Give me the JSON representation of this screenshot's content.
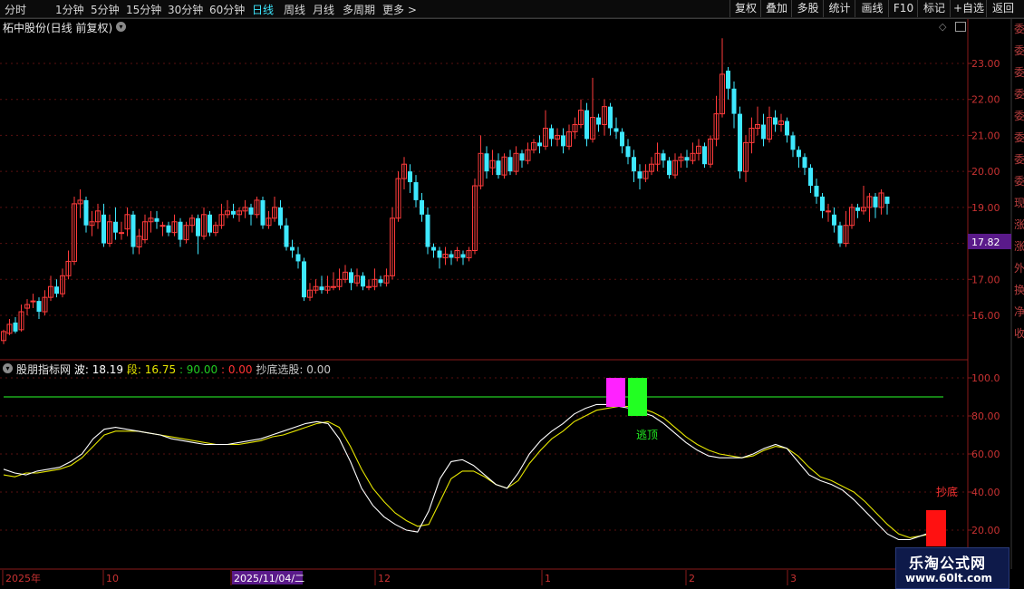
{
  "toolbar": {
    "periods": [
      "分时",
      "1分钟",
      "5分钟",
      "15分钟",
      "30分钟",
      "60分钟",
      "日线",
      "周线",
      "月线",
      "多周期",
      "更多 >"
    ],
    "active_period": "日线",
    "right_buttons": [
      "复权",
      "叠加",
      "多股",
      "统计",
      "画线",
      "F10",
      "标记",
      "+自选",
      "返回"
    ]
  },
  "stock": {
    "title": "柘中股份(日线 前复权)"
  },
  "price_axis": {
    "labels": [
      "23.00",
      "22.00",
      "21.00",
      "20.00",
      "19.00",
      "17.00",
      "16.00"
    ],
    "current_price": "17.82",
    "current_price_color": "#5a1a8a"
  },
  "side_labels": [
    "委",
    "委",
    "委",
    "委",
    "委",
    "委",
    "委",
    "委",
    "现",
    "涨",
    "涨",
    "外",
    "换",
    "净",
    "收"
  ],
  "indicator": {
    "name": "股朋指标网",
    "wave_label": "波: 18.19",
    "segment_label": "段: 16.75",
    "level_90": ": 90.00",
    "level_0": ": 0.00",
    "screen_label": "抄底选股: 0.00",
    "axis_labels": [
      "100.0",
      "80.00",
      "60.00",
      "40.00",
      "20.00"
    ],
    "signal_top": "逃顶",
    "signal_bottom": "抄底",
    "colors": {
      "wave": "#ffffff",
      "segment": "#e6e600",
      "level_line": "#22cc22",
      "top_block": "#ff22ff",
      "escape_block": "#22ff22",
      "bottom_block": "#ff1111"
    }
  },
  "date_axis": {
    "labels": [
      "2025年",
      "10",
      "2025/11/04/二",
      "12",
      "1",
      "2",
      "3"
    ]
  },
  "watermark": {
    "name": "乐淘公式网",
    "url": "www.60lt.com"
  },
  "candle_colors": {
    "up": "#ff3b3b",
    "down": "#3ee8ff"
  },
  "candles": [
    [
      15.3,
      15.55,
      15.2,
      15.6
    ],
    [
      15.5,
      15.75,
      15.45,
      15.9
    ],
    [
      15.8,
      15.55,
      15.5,
      15.95
    ],
    [
      15.6,
      16.1,
      15.55,
      16.3
    ],
    [
      16.2,
      16.3,
      16.0,
      16.45
    ],
    [
      16.4,
      16.4,
      16.2,
      16.6
    ],
    [
      16.4,
      16.1,
      15.9,
      16.5
    ],
    [
      16.1,
      16.5,
      16.0,
      16.7
    ],
    [
      16.5,
      16.8,
      16.4,
      17.1
    ],
    [
      16.8,
      16.6,
      16.5,
      17.0
    ],
    [
      16.6,
      17.1,
      16.5,
      17.3
    ],
    [
      17.1,
      17.5,
      17.0,
      17.8
    ],
    [
      17.5,
      19.1,
      17.4,
      19.3
    ],
    [
      19.1,
      19.2,
      18.7,
      19.5
    ],
    [
      19.2,
      18.5,
      18.3,
      19.3
    ],
    [
      18.5,
      18.6,
      18.2,
      18.9
    ],
    [
      18.6,
      18.9,
      18.4,
      19.1
    ],
    [
      18.8,
      18.0,
      17.9,
      19.1
    ],
    [
      18.0,
      18.6,
      17.9,
      18.8
    ],
    [
      18.6,
      18.3,
      18.1,
      19.0
    ],
    [
      18.3,
      18.3,
      18.1,
      18.6
    ],
    [
      18.4,
      18.8,
      18.2,
      19.0
    ],
    [
      18.8,
      17.9,
      17.7,
      18.9
    ],
    [
      17.9,
      18.2,
      17.7,
      18.4
    ],
    [
      18.1,
      18.6,
      18.0,
      18.8
    ],
    [
      18.6,
      18.7,
      18.3,
      18.9
    ],
    [
      18.7,
      18.6,
      18.4,
      18.9
    ],
    [
      18.5,
      18.5,
      18.2,
      18.6
    ],
    [
      18.5,
      18.3,
      18.2,
      18.6
    ],
    [
      18.3,
      18.6,
      18.2,
      18.8
    ],
    [
      18.6,
      18.1,
      17.9,
      18.7
    ],
    [
      18.1,
      18.5,
      18.0,
      18.6
    ],
    [
      18.5,
      18.7,
      18.3,
      18.8
    ],
    [
      18.7,
      18.2,
      17.7,
      18.8
    ],
    [
      18.2,
      18.8,
      18.1,
      19.0
    ],
    [
      18.8,
      18.3,
      18.2,
      18.9
    ],
    [
      18.3,
      18.5,
      18.2,
      18.6
    ],
    [
      18.5,
      18.8,
      18.4,
      19.1
    ],
    [
      18.8,
      18.9,
      18.7,
      19.2
    ],
    [
      18.9,
      18.8,
      18.7,
      19.1
    ],
    [
      18.8,
      18.9,
      18.6,
      19.0
    ],
    [
      18.9,
      19.0,
      18.7,
      19.2
    ],
    [
      19.0,
      18.8,
      18.5,
      19.1
    ],
    [
      18.8,
      19.2,
      18.7,
      19.3
    ],
    [
      19.2,
      18.5,
      18.4,
      19.3
    ],
    [
      18.5,
      18.7,
      18.4,
      18.9
    ],
    [
      18.7,
      19.0,
      18.6,
      19.3
    ],
    [
      19.0,
      18.5,
      18.4,
      19.2
    ],
    [
      18.5,
      17.9,
      17.8,
      18.7
    ],
    [
      17.9,
      17.8,
      17.6,
      18.1
    ],
    [
      17.7,
      17.5,
      17.3,
      17.9
    ],
    [
      17.5,
      16.5,
      16.4,
      17.6
    ],
    [
      16.5,
      16.7,
      16.4,
      16.9
    ],
    [
      16.7,
      16.8,
      16.6,
      17.0
    ],
    [
      16.8,
      16.7,
      16.6,
      17.1
    ],
    [
      16.7,
      16.8,
      16.6,
      17.1
    ],
    [
      16.8,
      16.8,
      16.7,
      17.2
    ],
    [
      16.8,
      17.0,
      16.7,
      17.3
    ],
    [
      17.0,
      17.2,
      16.9,
      17.4
    ],
    [
      17.2,
      16.9,
      16.7,
      17.3
    ],
    [
      16.9,
      17.1,
      16.8,
      17.3
    ],
    [
      17.1,
      16.8,
      16.7,
      17.2
    ],
    [
      16.8,
      16.8,
      16.7,
      17.0
    ],
    [
      16.8,
      17.0,
      16.7,
      17.3
    ],
    [
      17.0,
      16.9,
      16.8,
      17.1
    ],
    [
      16.9,
      17.1,
      16.8,
      17.3
    ],
    [
      17.1,
      18.7,
      17.0,
      19.0
    ],
    [
      18.7,
      19.8,
      18.6,
      20.0
    ],
    [
      19.8,
      20.2,
      19.5,
      20.4
    ],
    [
      20.0,
      19.7,
      19.4,
      20.2
    ],
    [
      19.7,
      19.2,
      19.0,
      19.9
    ],
    [
      19.2,
      18.8,
      18.6,
      19.4
    ],
    [
      18.8,
      17.9,
      17.7,
      19.0
    ],
    [
      17.9,
      17.8,
      17.6,
      18.0
    ],
    [
      17.8,
      17.6,
      17.3,
      17.9
    ],
    [
      17.6,
      17.7,
      17.4,
      17.9
    ],
    [
      17.7,
      17.6,
      17.4,
      17.8
    ],
    [
      17.6,
      17.8,
      17.5,
      17.9
    ],
    [
      17.7,
      17.6,
      17.4,
      17.8
    ],
    [
      17.6,
      17.8,
      17.5,
      17.9
    ],
    [
      17.8,
      19.6,
      17.7,
      19.8
    ],
    [
      19.6,
      20.5,
      19.5,
      21.0
    ],
    [
      20.5,
      20.0,
      19.8,
      20.7
    ],
    [
      20.1,
      20.3,
      19.9,
      20.6
    ],
    [
      20.3,
      19.9,
      19.8,
      20.5
    ],
    [
      19.9,
      20.4,
      19.8,
      20.5
    ],
    [
      20.4,
      20.0,
      19.9,
      20.6
    ],
    [
      20.0,
      20.5,
      19.9,
      20.7
    ],
    [
      20.5,
      20.3,
      20.1,
      20.6
    ],
    [
      20.3,
      20.6,
      20.2,
      20.8
    ],
    [
      20.6,
      20.8,
      20.5,
      20.9
    ],
    [
      20.8,
      20.7,
      20.5,
      21.0
    ],
    [
      20.7,
      21.2,
      20.6,
      21.7
    ],
    [
      21.2,
      20.9,
      20.7,
      21.3
    ],
    [
      20.9,
      21.0,
      20.7,
      21.2
    ],
    [
      21.0,
      20.7,
      20.5,
      21.2
    ],
    [
      20.7,
      21.1,
      20.6,
      21.3
    ],
    [
      21.1,
      21.3,
      20.9,
      21.5
    ],
    [
      21.3,
      21.7,
      21.2,
      22.0
    ],
    [
      21.7,
      20.9,
      20.7,
      21.9
    ],
    [
      20.9,
      21.5,
      20.8,
      22.6
    ],
    [
      21.5,
      21.3,
      21.1,
      21.6
    ],
    [
      21.3,
      21.8,
      21.0,
      22.0
    ],
    [
      21.8,
      21.2,
      21.0,
      21.9
    ],
    [
      21.2,
      21.1,
      20.9,
      21.5
    ],
    [
      21.1,
      20.7,
      20.5,
      21.2
    ],
    [
      20.7,
      20.4,
      20.2,
      20.9
    ],
    [
      20.4,
      20.0,
      19.7,
      20.6
    ],
    [
      20.0,
      19.8,
      19.5,
      20.2
    ],
    [
      19.8,
      20.0,
      19.7,
      20.2
    ],
    [
      20.0,
      20.2,
      19.9,
      20.4
    ],
    [
      20.2,
      20.5,
      20.0,
      20.8
    ],
    [
      20.5,
      20.3,
      20.1,
      20.6
    ],
    [
      20.3,
      19.9,
      19.8,
      20.4
    ],
    [
      19.9,
      20.3,
      19.8,
      20.5
    ],
    [
      20.3,
      20.4,
      20.1,
      20.5
    ],
    [
      20.4,
      20.3,
      20.1,
      20.6
    ],
    [
      20.3,
      20.5,
      20.2,
      20.8
    ],
    [
      20.5,
      20.7,
      20.3,
      20.9
    ],
    [
      20.7,
      20.2,
      20.1,
      20.8
    ],
    [
      20.2,
      20.9,
      20.1,
      21.0
    ],
    [
      20.9,
      21.6,
      20.7,
      22.1
    ],
    [
      21.6,
      22.7,
      21.5,
      23.7
    ],
    [
      22.8,
      22.3,
      22.0,
      22.9
    ],
    [
      22.3,
      21.6,
      21.2,
      22.5
    ],
    [
      21.6,
      20.0,
      19.8,
      21.8
    ],
    [
      20.0,
      20.8,
      19.7,
      21.0
    ],
    [
      20.8,
      21.2,
      20.5,
      21.5
    ],
    [
      21.2,
      21.3,
      21.0,
      21.8
    ],
    [
      21.3,
      20.9,
      20.7,
      21.6
    ],
    [
      20.9,
      21.5,
      20.8,
      21.8
    ],
    [
      21.5,
      21.3,
      21.1,
      21.7
    ],
    [
      21.3,
      21.4,
      21.1,
      21.6
    ],
    [
      21.4,
      21.0,
      20.8,
      21.5
    ],
    [
      21.0,
      20.6,
      20.4,
      21.1
    ],
    [
      20.6,
      20.4,
      20.1,
      20.7
    ],
    [
      20.4,
      20.1,
      19.9,
      20.5
    ],
    [
      20.1,
      19.6,
      19.4,
      20.2
    ],
    [
      19.6,
      19.3,
      19.1,
      19.8
    ],
    [
      19.3,
      18.9,
      18.7,
      19.4
    ],
    [
      18.9,
      18.9,
      18.6,
      19.1
    ],
    [
      18.8,
      18.5,
      18.3,
      19.0
    ],
    [
      18.5,
      18.0,
      17.9,
      18.6
    ],
    [
      18.0,
      18.5,
      17.9,
      18.9
    ],
    [
      18.5,
      19.0,
      18.4,
      19.1
    ],
    [
      19.0,
      18.9,
      18.7,
      19.1
    ],
    [
      18.9,
      19.0,
      18.8,
      19.6
    ],
    [
      19.0,
      19.3,
      18.6,
      19.4
    ],
    [
      19.3,
      19.0,
      18.7,
      19.4
    ],
    [
      19.0,
      19.4,
      18.8,
      19.5
    ],
    [
      19.3,
      19.1,
      18.8,
      19.3
    ]
  ],
  "indicator_series": {
    "wave": [
      52,
      50,
      49,
      51,
      52,
      53,
      56,
      60,
      68,
      73,
      74,
      73,
      72,
      71,
      70,
      68,
      67,
      66,
      65,
      65,
      65,
      66,
      67,
      68,
      70,
      72,
      74,
      76,
      77,
      76,
      68,
      56,
      42,
      33,
      27,
      23,
      20,
      19,
      30,
      47,
      56,
      57,
      54,
      49,
      44,
      42,
      50,
      60,
      67,
      72,
      76,
      81,
      84,
      86,
      86,
      85,
      84,
      82,
      80,
      76,
      71,
      66,
      62,
      59,
      58,
      58,
      58,
      60,
      63,
      65,
      63,
      56,
      49,
      46,
      44,
      41,
      36,
      30,
      24,
      18,
      15,
      15,
      17,
      19,
      19
    ],
    "segment": [
      49,
      48,
      50,
      50,
      51,
      52,
      54,
      58,
      64,
      70,
      72,
      72,
      72,
      71,
      70,
      69,
      68,
      67,
      66,
      65,
      65,
      65,
      66,
      67,
      69,
      70,
      72,
      74,
      76,
      77,
      74,
      64,
      52,
      42,
      35,
      29,
      25,
      22,
      23,
      35,
      47,
      51,
      51,
      48,
      44,
      42,
      46,
      55,
      62,
      68,
      72,
      77,
      80,
      83,
      84,
      85,
      85,
      84,
      82,
      79,
      74,
      69,
      65,
      62,
      60,
      59,
      58,
      59,
      62,
      64,
      63,
      59,
      53,
      48,
      46,
      43,
      40,
      35,
      29,
      23,
      18,
      16,
      17,
      18,
      18
    ]
  }
}
